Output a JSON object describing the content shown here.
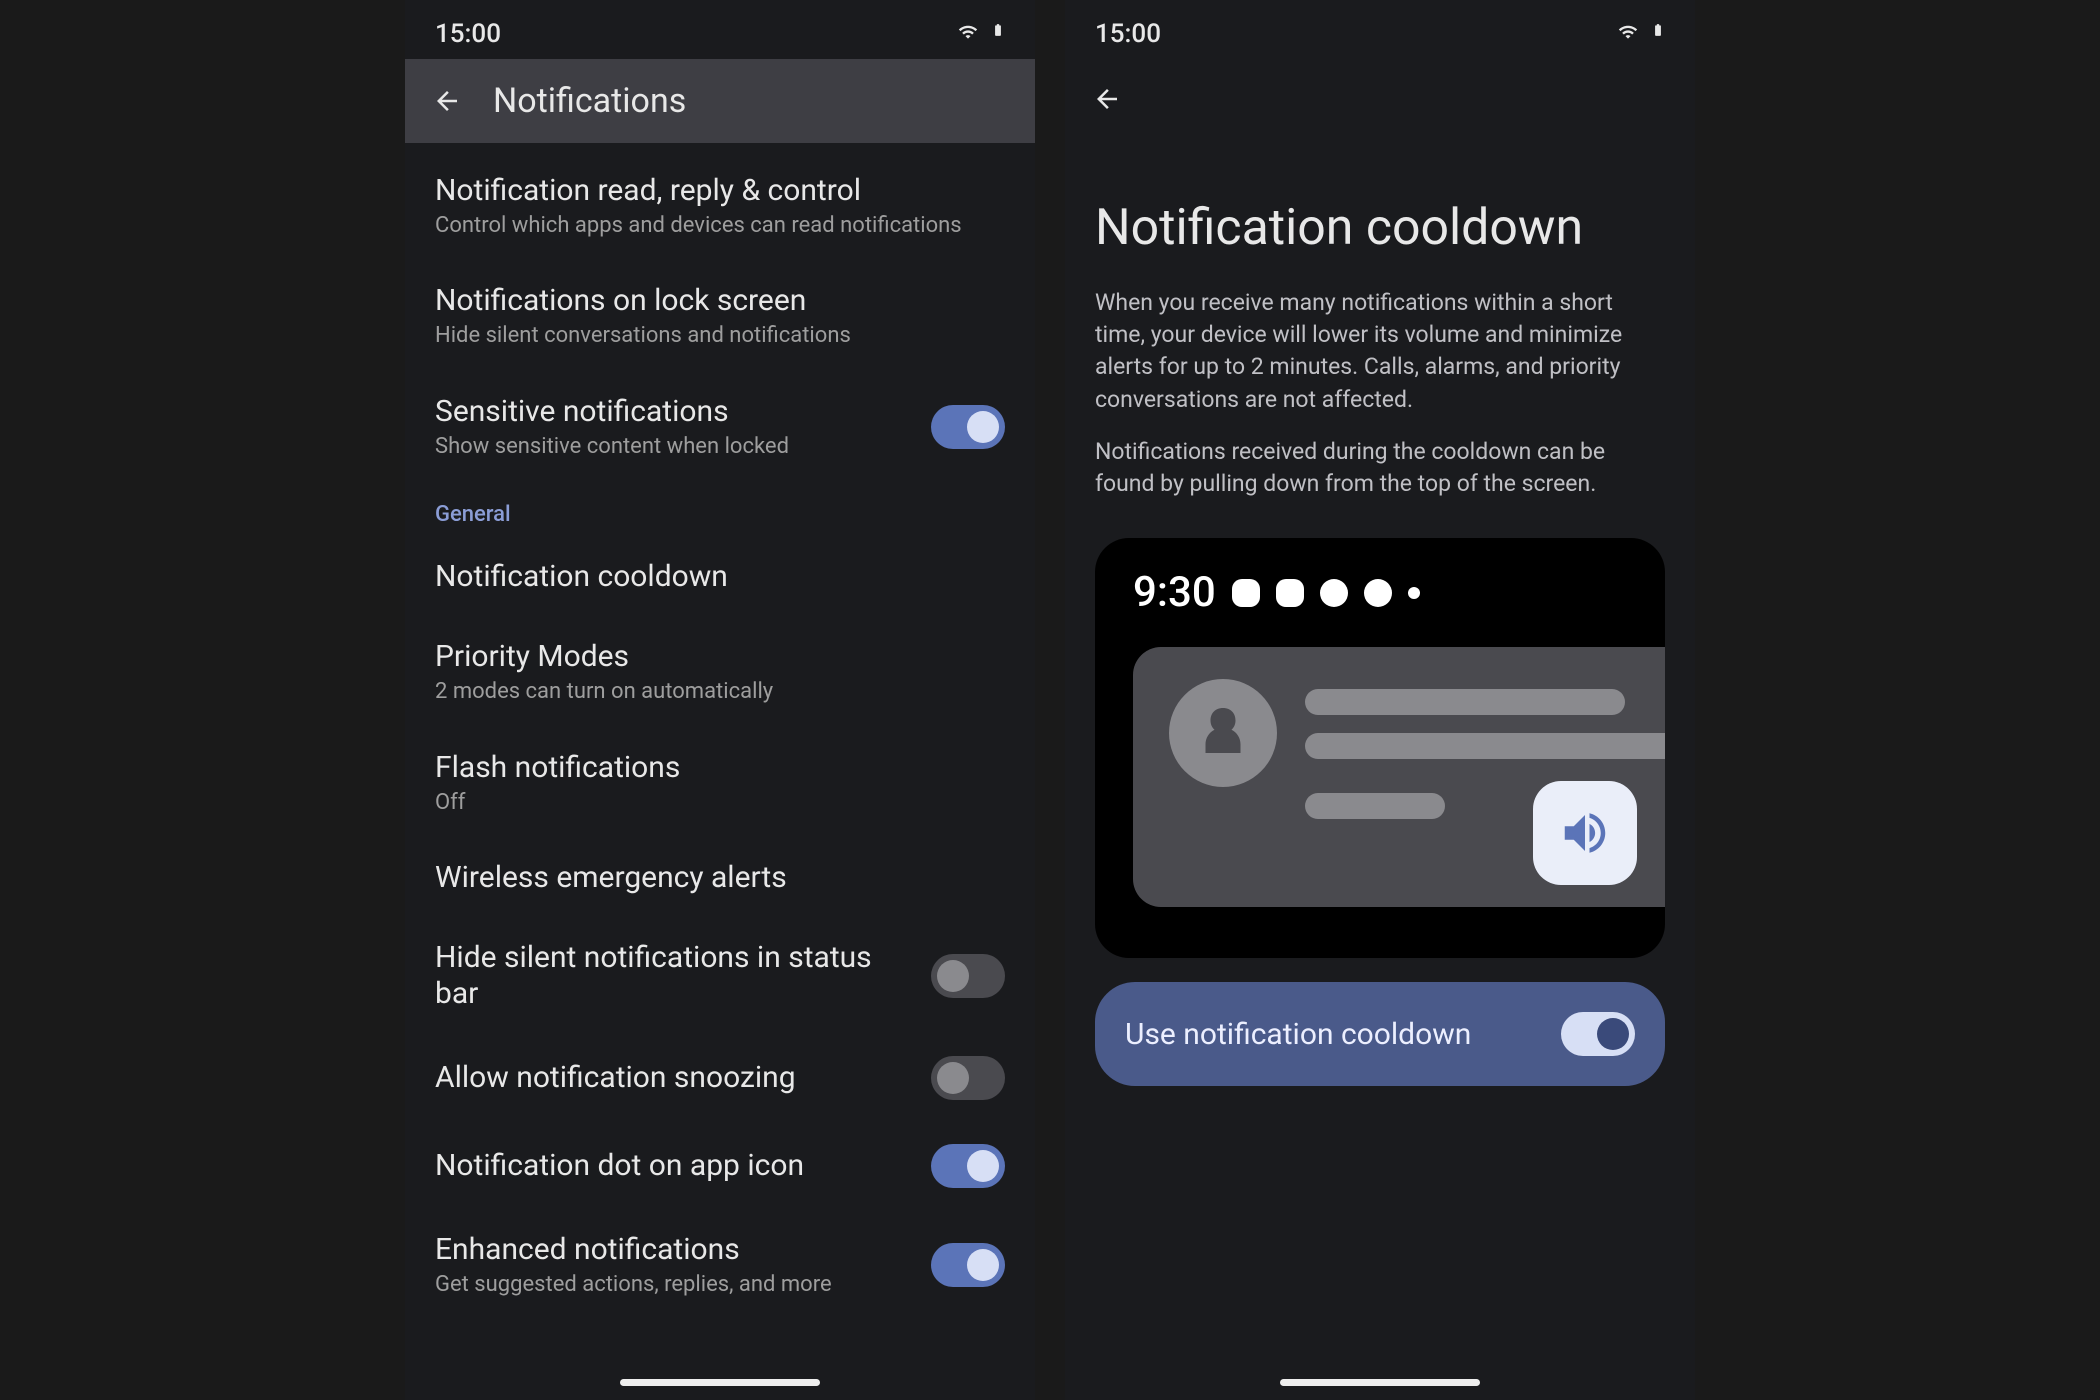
{
  "status_time": "15:00",
  "left": {
    "appbar_title": "Notifications",
    "items": [
      {
        "title": "Notification read, reply & control",
        "sub": "Control which apps and devices can read notifications",
        "toggle": null
      },
      {
        "title": "Notifications on lock screen",
        "sub": "Hide silent conversations and notifications",
        "toggle": null
      },
      {
        "title": "Sensitive notifications",
        "sub": "Show sensitive content when locked",
        "toggle": true
      }
    ],
    "section": "General",
    "general_items": [
      {
        "title": "Notification cooldown",
        "sub": "",
        "toggle": null
      },
      {
        "title": "Priority Modes",
        "sub": "2 modes can turn on automatically",
        "toggle": null
      },
      {
        "title": "Flash notifications",
        "sub": "Off",
        "toggle": null
      },
      {
        "title": "Wireless emergency alerts",
        "sub": "",
        "toggle": null
      },
      {
        "title": "Hide silent notifications in status bar",
        "sub": "",
        "toggle": false
      },
      {
        "title": "Allow notification snoozing",
        "sub": "",
        "toggle": false
      },
      {
        "title": "Notification dot on app icon",
        "sub": "",
        "toggle": true
      },
      {
        "title": "Enhanced notifications",
        "sub": "Get suggested actions, replies, and more",
        "toggle": true
      }
    ]
  },
  "right": {
    "title": "Notification cooldown",
    "para1": "When you receive many notifications within a short time, your device will lower its volume and minimize alerts for up to 2 minutes. Calls, alarms, and priority conversations are not affected.",
    "para2": "Notifications received during the cooldown can be found by pulling down from the top of the screen.",
    "illus_time": "9:30",
    "toggle_label": "Use notification cooldown",
    "toggle_state": true
  }
}
